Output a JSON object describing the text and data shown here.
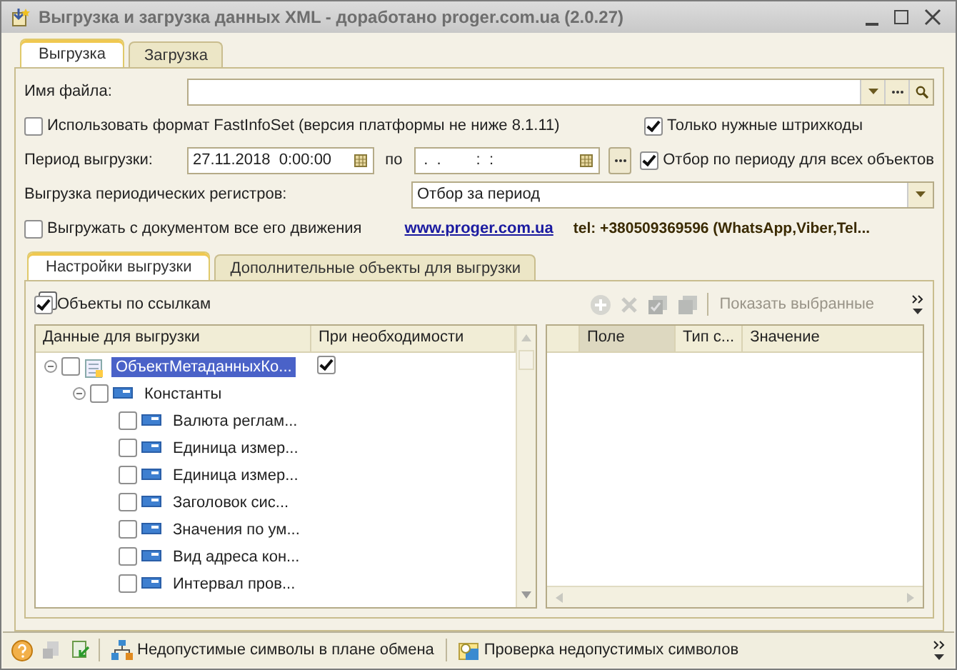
{
  "window": {
    "title": "Выгрузка и загрузка данных XML - доработано proger.com.ua (2.0.27)"
  },
  "tabs": [
    {
      "label": "Выгрузка",
      "selected": true
    },
    {
      "label": "Загрузка",
      "selected": false
    }
  ],
  "file_name": {
    "label": "Имя файла:"
  },
  "fast_infoset": {
    "label": "Использовать формат FastInfoSet (версия платформы не ниже 8.1.11)",
    "checked": false
  },
  "barcodes": {
    "label": "Только нужные штрихкоды",
    "checked": true
  },
  "period": {
    "label": "Период выгрузки:",
    "from": "27.11.2018  0:00:00",
    "separator": "по",
    "to": " .  .        :  :"
  },
  "period_filter": {
    "label": "Отбор по периоду для всех объектов",
    "checked": true
  },
  "registers": {
    "label": "Выгрузка периодических регистров:",
    "value": "Отбор за период"
  },
  "movements": {
    "label": "Выгружать с документом все его движения",
    "checked": false
  },
  "link": "www.proger.com.ua",
  "phone": "tel: +380509369596 (WhatsApp,Viber,Tel...",
  "inner_tabs": [
    {
      "label": "Настройки выгрузки",
      "selected": true
    },
    {
      "label": "Дополнительные объекты для выгрузки",
      "selected": false
    }
  ],
  "by_reference": {
    "label": "Объекты по ссылкам",
    "checked": true
  },
  "show_selected": "Показать выбранные",
  "tree": {
    "columns": [
      "Данные для выгрузки",
      "При необходимости"
    ],
    "items": [
      {
        "label": "ОбъектМетаданныхКо...",
        "checked": false,
        "selected": true,
        "expanded": true,
        "when_needed": true,
        "children": [
          {
            "label": "Константы",
            "checked": false,
            "selected": false,
            "expanded": true,
            "children": [
              {
                "label": "Валюта реглам...",
                "checked": false,
                "selected": false
              },
              {
                "label": "Единица измер...",
                "checked": false,
                "selected": false
              },
              {
                "label": "Единица измер...",
                "checked": false,
                "selected": false
              },
              {
                "label": "Заголовок сис...",
                "checked": false,
                "selected": false
              },
              {
                "label": "Значения по ум...",
                "checked": false,
                "selected": false
              },
              {
                "label": "Вид адреса кон...",
                "checked": false,
                "selected": false
              },
              {
                "label": "Интервал пров...",
                "checked": false,
                "selected": false
              }
            ]
          }
        ]
      }
    ]
  },
  "fields_table": {
    "columns": [
      "Поле",
      "Тип с...",
      "Значение"
    ]
  },
  "bottom_bar": [
    "Недопустимые символы в плане обмена",
    "Проверка недопустимых символов"
  ]
}
